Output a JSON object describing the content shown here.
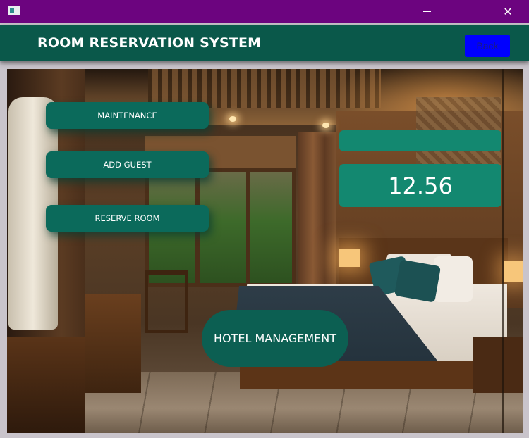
{
  "window": {
    "controls": {
      "minimize_icon": "minimize-icon",
      "maximize_icon": "maximize-icon",
      "close_icon": "close-icon"
    }
  },
  "header": {
    "title": "ROOM RESERVATION SYSTEM",
    "back_label": "Back"
  },
  "menu": {
    "maintenance_label": "MAINTENANCE",
    "add_guest_label": "ADD GUEST",
    "reserve_room_label": "RESERVE ROOM"
  },
  "display": {
    "top_text": "",
    "value": "12.56"
  },
  "footer": {
    "hotel_button_label": "HOTEL MANAGEMENT"
  },
  "colors": {
    "titlebar": "#6c047f",
    "header": "#0a584a",
    "button": "#0b6a5b",
    "display": "#138870",
    "back_button": "#0000ff"
  }
}
